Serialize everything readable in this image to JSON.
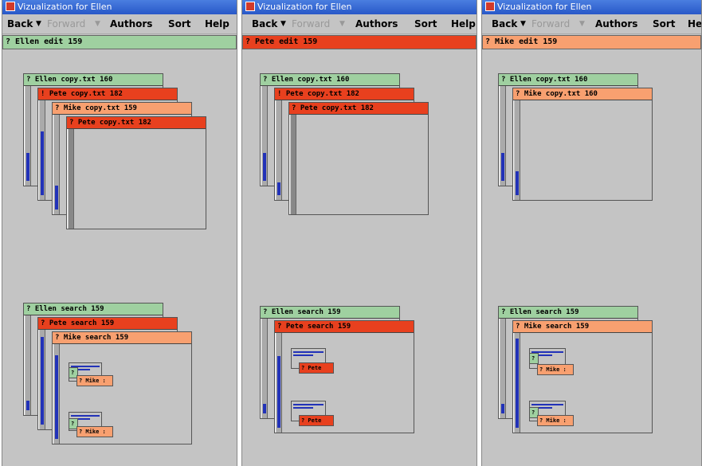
{
  "colors": {
    "green": "#9fd0a0",
    "red": "#e8401e",
    "orange": "#f8a070",
    "blue": "#2232b8"
  },
  "windows": [
    {
      "title": "Vizualization for Ellen",
      "menu": {
        "back": "Back",
        "forward": "Forward",
        "authors": "Authors",
        "sort": "Sort",
        "help": "Help"
      },
      "header": "?  Ellen  edit  159",
      "header_color": "green",
      "edit_frames": [
        {
          "label": "? Ellen copy.txt 160",
          "color": "green"
        },
        {
          "label": "! Pete copy.txt 182",
          "color": "red"
        },
        {
          "label": "? Mike copy.txt 159",
          "color": "orange"
        },
        {
          "label": "? Pete copy.txt 182",
          "color": "red"
        }
      ],
      "search_frames": [
        {
          "label": "? Ellen search 159",
          "color": "green"
        },
        {
          "label": "? Pete search 159",
          "color": "red"
        },
        {
          "label": "? Mike search 159",
          "color": "orange"
        }
      ],
      "chips": [
        {
          "label": "?",
          "color": "green"
        },
        {
          "label": "? Mike :",
          "color": "orange"
        },
        {
          "label": "?",
          "color": "green"
        },
        {
          "label": "? Mike :",
          "color": "orange"
        }
      ]
    },
    {
      "title": "Vizualization for Ellen",
      "menu": {
        "back": "Back",
        "forward": "Forward",
        "authors": "Authors",
        "sort": "Sort",
        "help": "Help"
      },
      "header": "?  Pete  edit  159",
      "header_color": "red",
      "edit_frames": [
        {
          "label": "? Ellen copy.txt 160",
          "color": "green"
        },
        {
          "label": "! Pete copy.txt 182",
          "color": "red"
        },
        {
          "label": "? Pete copy.txt 182",
          "color": "red"
        }
      ],
      "search_frames": [
        {
          "label": "? Ellen search 159",
          "color": "green"
        },
        {
          "label": "? Pete search 159",
          "color": "red"
        }
      ],
      "chips": [
        {
          "label": "? Pete",
          "color": "red"
        },
        {
          "label": "? Pete",
          "color": "red"
        }
      ]
    },
    {
      "title": "Vizualization for Ellen",
      "menu": {
        "back": "Back",
        "forward": "Forward",
        "authors": "Authors",
        "sort": "Sort",
        "help": "Help"
      },
      "header": "?  Mike  edit  159",
      "header_color": "orange",
      "edit_frames": [
        {
          "label": "? Ellen copy.txt 160",
          "color": "green"
        },
        {
          "label": "? Mike copy.txt 160",
          "color": "orange"
        }
      ],
      "search_frames": [
        {
          "label": "? Ellen search 159",
          "color": "green"
        },
        {
          "label": "? Mike search 159",
          "color": "orange"
        }
      ],
      "chips": [
        {
          "label": "?",
          "color": "green"
        },
        {
          "label": "? Mike :",
          "color": "orange"
        },
        {
          "label": "?",
          "color": "green"
        },
        {
          "label": "? Mike :",
          "color": "orange"
        }
      ]
    }
  ]
}
